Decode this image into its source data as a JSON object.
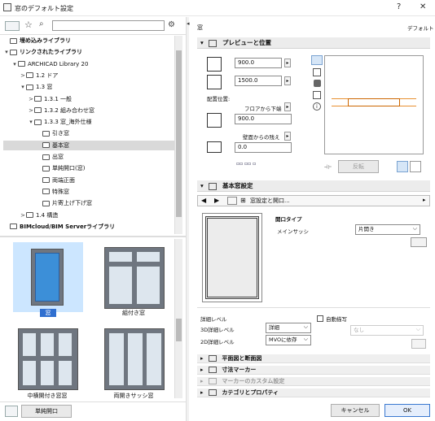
{
  "window": {
    "title": "窓のデフォルト設定",
    "help": "?",
    "close": "✕"
  },
  "left": {
    "search_placeholder": "",
    "tree": [
      {
        "label": "埋め込みライブラリ",
        "level": 0,
        "bold": true
      },
      {
        "label": "リンクされたライブラリ",
        "level": 0,
        "bold": true,
        "caret": "▾"
      },
      {
        "label": "ARCHICAD Library 20",
        "level": 1,
        "caret": "▾"
      },
      {
        "label": "1.2 ドア",
        "level": 2,
        "caret": ">"
      },
      {
        "label": "1.3 窓",
        "level": 2,
        "caret": "▾"
      },
      {
        "label": "1.3.1 一般",
        "level": 3,
        "caret": ">"
      },
      {
        "label": "1.3.2 組み合わせ窓",
        "level": 3,
        "caret": ">"
      },
      {
        "label": "1.3.3 窓_海外仕様",
        "level": 3,
        "caret": "▾"
      },
      {
        "label": "引き窓",
        "level": 4
      },
      {
        "label": "基本窓",
        "level": 4,
        "selected": true
      },
      {
        "label": "出窓",
        "level": 4
      },
      {
        "label": "単純開口(窓)",
        "level": 4
      },
      {
        "label": "両端正面",
        "level": 4
      },
      {
        "label": "特殊窓",
        "level": 4
      },
      {
        "label": "片寄上げ下げ窓",
        "level": 4
      },
      {
        "label": "1.4 構造",
        "level": 2,
        "caret": ">"
      },
      {
        "label": "BIMcloud/BIM Serverライブラリ",
        "level": 0,
        "bold": true
      }
    ],
    "gallery": [
      {
        "label": "窓",
        "selected": true
      },
      {
        "label": "組付き窓"
      },
      {
        "label": "中横開付き窓窓"
      },
      {
        "label": "両開きサッシ窓"
      }
    ],
    "footer_button": "単純開口"
  },
  "right": {
    "object_name": "窓",
    "defaults_label": "デフォルト",
    "preview_section": "プレビューと位置",
    "width_value": "900.0",
    "height_value": "1500.0",
    "placement_label": "配置位置:",
    "from_floor_label": "フロアから下端",
    "sill_value": "900.0",
    "wall_offset_label": "壁面からの残え",
    "offset_value": "0.0",
    "mirror_label": "反転",
    "params_section": "基本窓設定",
    "params_subheader": "窓設定と開口...",
    "opening_type_label": "開口タイプ",
    "main_sash_label": "メインサッシ",
    "sash_option": "片開き",
    "detail_level_label": "詳細レベル",
    "detail_3d_label": "3D詳細レベル",
    "detail_3d_value": "詳細",
    "detail_2d_label": "2D詳細レベル",
    "detail_2d_value": "MVOに依存",
    "auto_mirror_label": "自動描写",
    "auto_mirror_dd": "なし",
    "collapsed_sections": [
      "平面図と断面図",
      "寸法マーカー",
      "マーカーのカスタム設定",
      "カテゴリとプロパティ"
    ],
    "cancel": "キャンセル",
    "ok": "OK"
  }
}
